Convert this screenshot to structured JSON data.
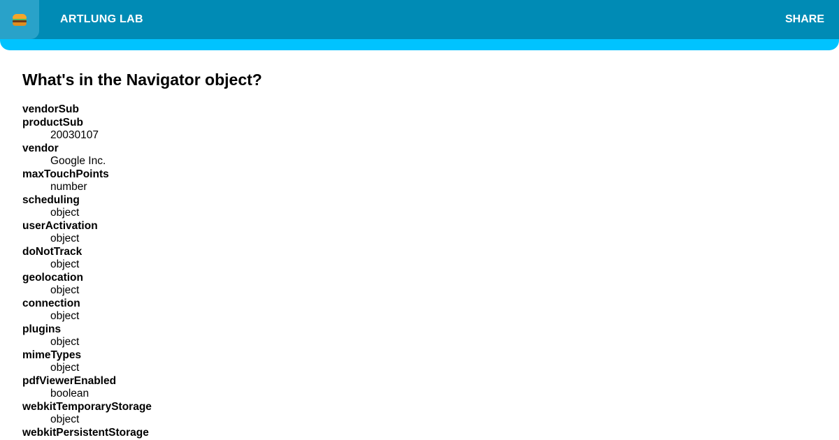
{
  "header": {
    "menu_icon": "hamburger-food-icon",
    "brand": "ARTLUNG LAB",
    "share_label": "SHARE",
    "colors": {
      "bar": "#008bb5",
      "accent_strip": "#00c3ff",
      "menu_button": "#29a2c9"
    }
  },
  "main": {
    "title": "What's in the Navigator object?",
    "properties": [
      {
        "name": "vendorSub",
        "value": ""
      },
      {
        "name": "productSub",
        "value": "20030107"
      },
      {
        "name": "vendor",
        "value": "Google Inc."
      },
      {
        "name": "maxTouchPoints",
        "value": "number"
      },
      {
        "name": "scheduling",
        "value": "object"
      },
      {
        "name": "userActivation",
        "value": "object"
      },
      {
        "name": "doNotTrack",
        "value": "object"
      },
      {
        "name": "geolocation",
        "value": "object"
      },
      {
        "name": "connection",
        "value": "object"
      },
      {
        "name": "plugins",
        "value": "object"
      },
      {
        "name": "mimeTypes",
        "value": "object"
      },
      {
        "name": "pdfViewerEnabled",
        "value": "boolean"
      },
      {
        "name": "webkitTemporaryStorage",
        "value": "object"
      },
      {
        "name": "webkitPersistentStorage",
        "value": ""
      }
    ]
  }
}
